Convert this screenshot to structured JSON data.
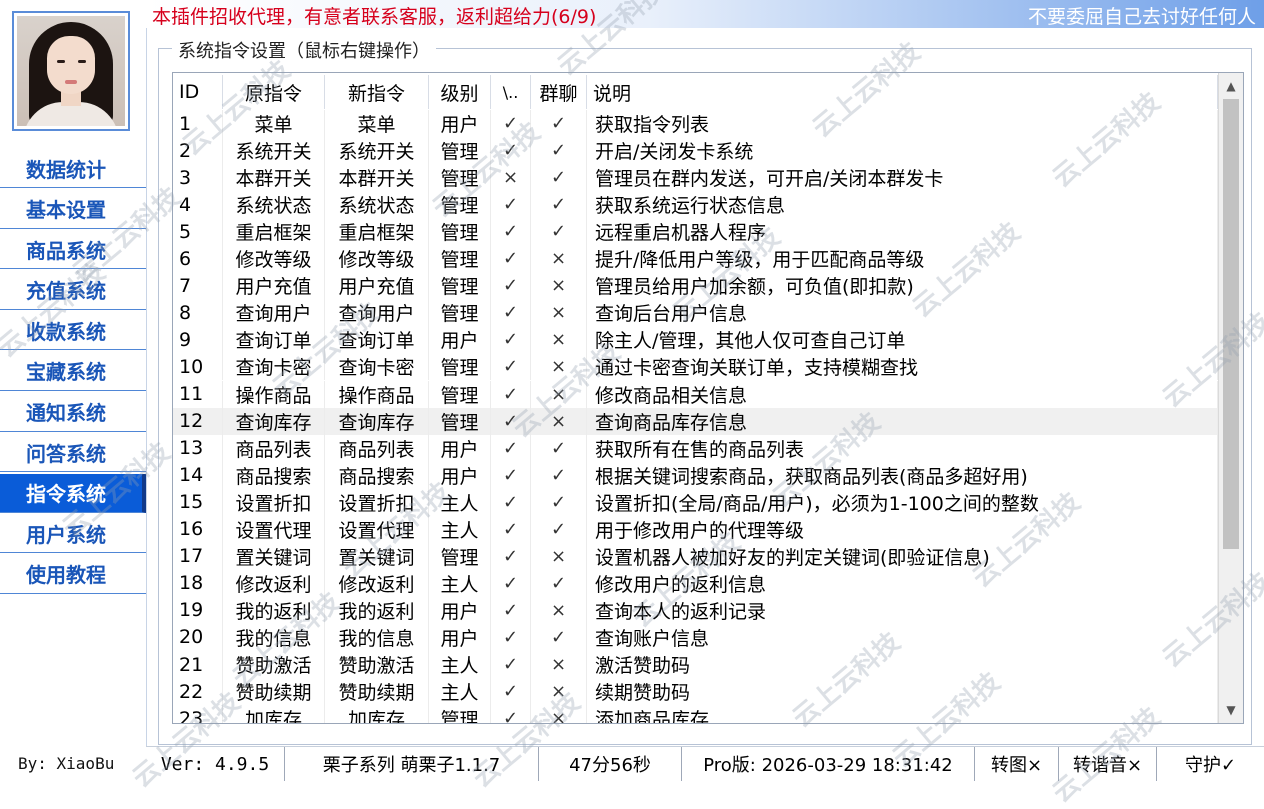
{
  "sidebar": {
    "nav": [
      "数据统计",
      "基本设置",
      "商品系统",
      "充值系统",
      "收款系统",
      "宝藏系统",
      "通知系统",
      "问答系统",
      "指令系统",
      "用户系统",
      "使用教程"
    ],
    "active_index": 8,
    "byline": "By: XiaoBu"
  },
  "banner": {
    "notice": "本插件招收代理，有意者联系客服，返利超给力(6/9)",
    "right_text": "不要委屈自己去讨好任何人",
    "notice_color": "#d6001c"
  },
  "group": {
    "title": "系统指令设置（鼠标右键操作）"
  },
  "table": {
    "headers": [
      "ID",
      "原指令",
      "新指令",
      "级别",
      "\\..",
      "群聊",
      "说明"
    ],
    "highlight_row": 11,
    "rows": [
      [
        "1",
        "菜单",
        "菜单",
        "用户",
        "✓",
        "✓",
        "获取指令列表"
      ],
      [
        "2",
        "系统开关",
        "系统开关",
        "管理",
        "✓",
        "✓",
        "开启/关闭发卡系统"
      ],
      [
        "3",
        "本群开关",
        "本群开关",
        "管理",
        "×",
        "✓",
        "管理员在群内发送，可开启/关闭本群发卡"
      ],
      [
        "4",
        "系统状态",
        "系统状态",
        "管理",
        "✓",
        "✓",
        "获取系统运行状态信息"
      ],
      [
        "5",
        "重启框架",
        "重启框架",
        "管理",
        "✓",
        "✓",
        "远程重启机器人程序"
      ],
      [
        "6",
        "修改等级",
        "修改等级",
        "管理",
        "✓",
        "×",
        "提升/降低用户等级，用于匹配商品等级"
      ],
      [
        "7",
        "用户充值",
        "用户充值",
        "管理",
        "✓",
        "×",
        "管理员给用户加余额，可负值(即扣款)"
      ],
      [
        "8",
        "查询用户",
        "查询用户",
        "管理",
        "✓",
        "×",
        "查询后台用户信息"
      ],
      [
        "9",
        "查询订单",
        "查询订单",
        "用户",
        "✓",
        "×",
        "除主人/管理，其他人仅可查自己订单"
      ],
      [
        "10",
        "查询卡密",
        "查询卡密",
        "管理",
        "✓",
        "×",
        "通过卡密查询关联订单，支持模糊查找"
      ],
      [
        "11",
        "操作商品",
        "操作商品",
        "管理",
        "✓",
        "×",
        "修改商品相关信息"
      ],
      [
        "12",
        "查询库存",
        "查询库存",
        "管理",
        "✓",
        "×",
        "查询商品库存信息"
      ],
      [
        "13",
        "商品列表",
        "商品列表",
        "用户",
        "✓",
        "✓",
        "获取所有在售的商品列表"
      ],
      [
        "14",
        "商品搜索",
        "商品搜索",
        "用户",
        "✓",
        "✓",
        "根据关键词搜索商品，获取商品列表(商品多超好用)"
      ],
      [
        "15",
        "设置折扣",
        "设置折扣",
        "主人",
        "✓",
        "✓",
        "设置折扣(全局/商品/用户)，必须为1-100之间的整数"
      ],
      [
        "16",
        "设置代理",
        "设置代理",
        "主人",
        "✓",
        "✓",
        "用于修改用户的代理等级"
      ],
      [
        "17",
        "置关键词",
        "置关键词",
        "管理",
        "✓",
        "×",
        "设置机器人被加好友的判定关键词(即验证信息)"
      ],
      [
        "18",
        "修改返利",
        "修改返利",
        "主人",
        "✓",
        "✓",
        "修改用户的返利信息"
      ],
      [
        "19",
        "我的返利",
        "我的返利",
        "用户",
        "✓",
        "×",
        "查询本人的返利记录"
      ],
      [
        "20",
        "我的信息",
        "我的信息",
        "用户",
        "✓",
        "✓",
        "查询账户信息"
      ],
      [
        "21",
        "赞助激活",
        "赞助激活",
        "主人",
        "✓",
        "×",
        "激活赞助码"
      ],
      [
        "22",
        "赞助续期",
        "赞助续期",
        "主人",
        "✓",
        "×",
        "续期赞助码"
      ],
      [
        "23",
        "加库存",
        "加库存",
        "管理",
        "✓",
        "×",
        "添加商品库存"
      ]
    ]
  },
  "status": {
    "version": "Ver: 4.9.5",
    "series": "栗子系列 萌栗子1.1.7",
    "runtime": "47分56秒",
    "pro": "Pro版: 2026-03-29 18:31:42",
    "btn1": "转图×",
    "btn2": "转谐音×",
    "btn3": "守护✓"
  },
  "watermark": {
    "text": "云上云科技"
  },
  "icons": {
    "scroll_up": "chevron-up-icon",
    "scroll_down": "chevron-down-icon"
  }
}
